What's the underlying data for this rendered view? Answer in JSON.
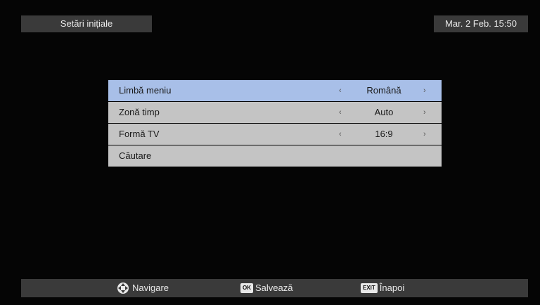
{
  "header": {
    "title": "Setări inițiale",
    "datetime": "Mar. 2 Feb. 15:50"
  },
  "menu": {
    "items": [
      {
        "label": "Limbă meniu",
        "value": "Română",
        "has_arrows": true,
        "selected": true
      },
      {
        "label": "Zonă timp",
        "value": "Auto",
        "has_arrows": true,
        "selected": false
      },
      {
        "label": "Formă TV",
        "value": "16:9",
        "has_arrows": true,
        "selected": false
      },
      {
        "label": "Căutare",
        "value": "",
        "has_arrows": false,
        "selected": false
      }
    ],
    "arrow_left": "‹",
    "arrow_right": "›"
  },
  "footer": {
    "navigate_label": "Navigare",
    "ok_key": "OK",
    "save_label": "Salvează",
    "exit_key": "EXIT",
    "back_label": "Înapoi"
  },
  "colors": {
    "background": "#050505",
    "panel": "#3a3a3a",
    "row": "#c4c4c4",
    "row_selected": "#a8bfe8"
  }
}
